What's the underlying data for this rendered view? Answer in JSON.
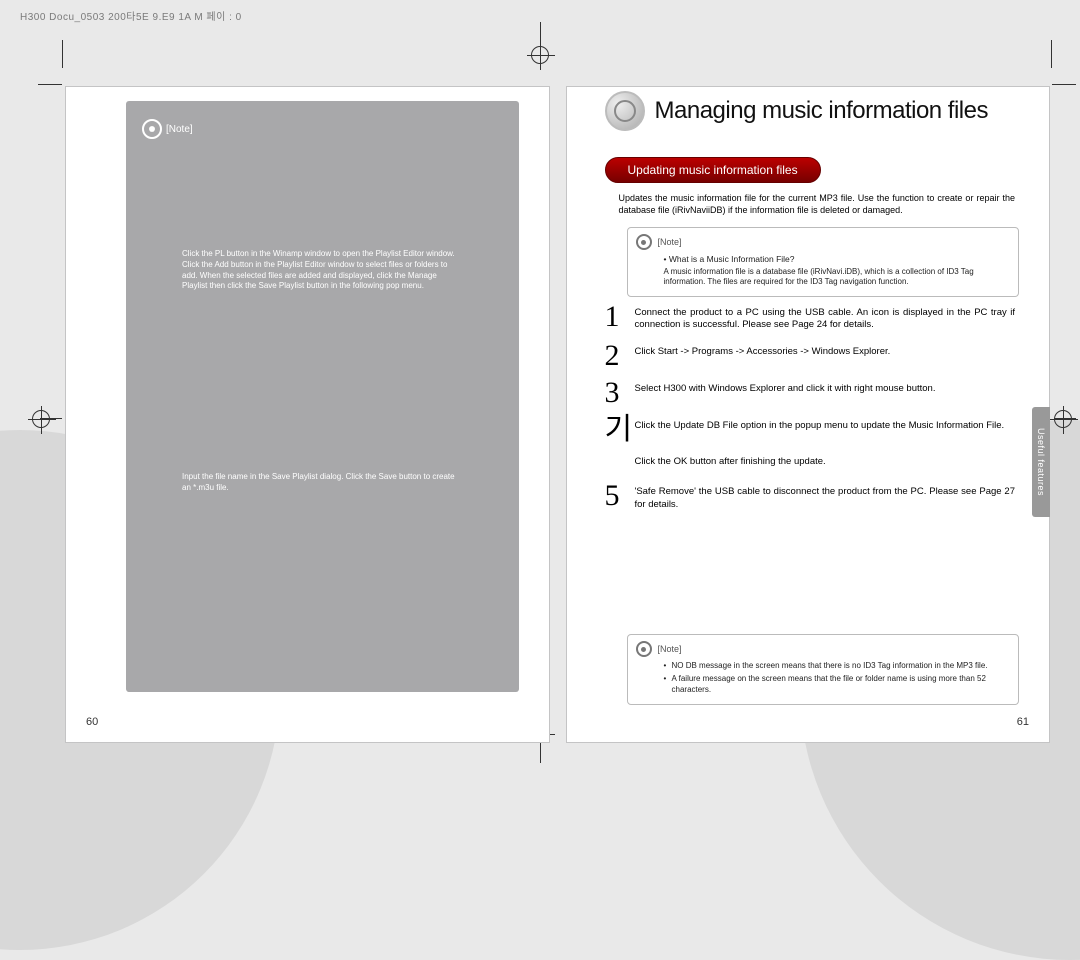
{
  "meta": {
    "header": "H300 Docu_0503   200타5E 9.E9 1A M 페이 : 0"
  },
  "left": {
    "pageno": "60",
    "note_label": "[Note]",
    "para1": "Click the PL button in the Winamp window to open the Playlist Editor window. Click the Add button in the Playlist Editor window to select files or folders to add. When the selected files are added and displayed, click the Manage Playlist then click the Save Playlist button in the following pop menu.",
    "para2": "Input the file name in the Save Playlist dialog. Click the Save button to create an *.m3u file."
  },
  "right": {
    "pageno": "61",
    "title": "Managing music information files",
    "pill": "Updating music information files",
    "intro": "Updates the music information file for the current MP3 file. Use the function to create or repair the database file (iRivNaviiDB) if the information file is deleted or damaged.",
    "note1_label": "[Note]",
    "note1_q": "• What is a Music Information File?",
    "note1_body": "A music information file is a database file (iRivNavi.iDB), which is a collection of ID3 Tag information. The files are required for the ID3 Tag navigation function.",
    "steps": [
      {
        "n": "1",
        "t": "Connect the product to a PC using the USB cable. An icon is displayed in the PC tray if connection is successful. Please see Page 24 for details."
      },
      {
        "n": "2",
        "t": "Click Start -> Programs -> Accessories -> Windows Explorer."
      },
      {
        "n": "3",
        "t": "Select H300 with Windows Explorer and click it with right mouse button."
      },
      {
        "n": "기",
        "t": "Click the Update DB File option in the popup menu to update the Music Information File."
      },
      {
        "n": "",
        "t": "Click the OK button after finishing the update."
      },
      {
        "n": "5",
        "t": "'Safe Remove' the USB cable to disconnect the product from the PC. Please see Page 27 for details."
      }
    ],
    "note2_label": "[Note]",
    "note2_b1": "NO DB message in the screen means that there is no ID3 Tag information in the MP3 file.",
    "note2_b2": "A failure message on the screen means that the file or folder name is using more than 52 characters.",
    "sidetab": "Useful features"
  }
}
